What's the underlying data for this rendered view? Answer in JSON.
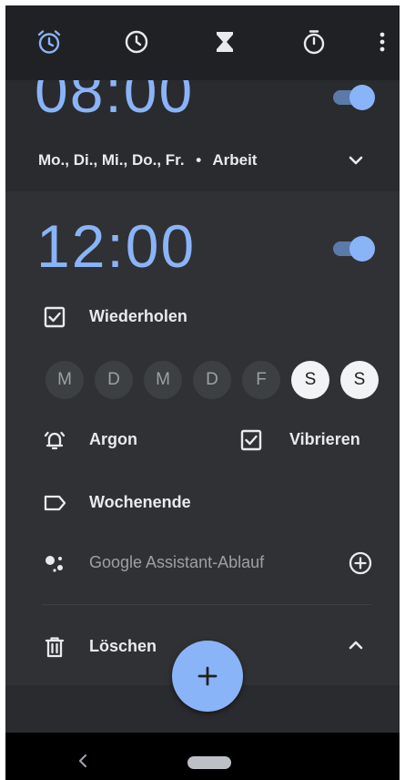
{
  "tabs": [
    {
      "name": "alarm",
      "icon": "alarm-clock-icon",
      "active": true
    },
    {
      "name": "clock",
      "icon": "clock-icon",
      "active": false
    },
    {
      "name": "timer",
      "icon": "hourglass-icon",
      "active": false
    },
    {
      "name": "stopwatch",
      "icon": "stopwatch-icon",
      "active": false
    }
  ],
  "alarms": [
    {
      "time": "08:00",
      "enabled": true,
      "days_summary": "Mo., Di., Mi., Do., Fr.",
      "separator": "•",
      "label": "Arbeit",
      "expanded": false
    },
    {
      "time": "12:00",
      "enabled": true,
      "expanded": true,
      "repeat_label": "Wiederholen",
      "repeat_checked": true,
      "days": [
        {
          "letter": "M",
          "on": false
        },
        {
          "letter": "D",
          "on": false
        },
        {
          "letter": "M",
          "on": false
        },
        {
          "letter": "D",
          "on": false
        },
        {
          "letter": "F",
          "on": false
        },
        {
          "letter": "S",
          "on": true
        },
        {
          "letter": "S",
          "on": true
        }
      ],
      "ringtone": "Argon",
      "vibrate_label": "Vibrieren",
      "vibrate_checked": true,
      "name": "Wochenende",
      "assistant_label": "Google Assistant-Ablauf",
      "delete_label": "Löschen"
    }
  ],
  "colors": {
    "accent": "#8ab4f8",
    "background": "#202124",
    "card": "#303134"
  }
}
